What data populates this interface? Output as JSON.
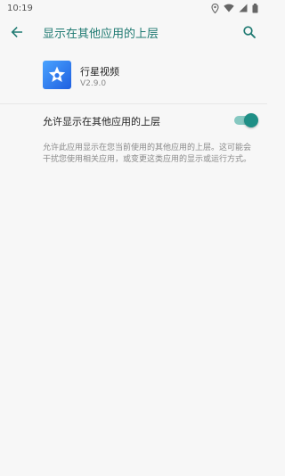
{
  "status_bar": {
    "time": "10:19",
    "icons": [
      "location-icon",
      "wifi-icon",
      "signal-icon",
      "battery-icon"
    ]
  },
  "app_bar": {
    "title": "显示在其他应用的上层",
    "back_icon": "back-arrow-icon",
    "search_icon": "search-icon",
    "accent_color": "#1f7a72"
  },
  "app": {
    "name": "行星视频",
    "version": "V2.9.0",
    "icon": "star-icon"
  },
  "setting": {
    "label": "允许显示在其他应用的上层",
    "enabled": true,
    "description": "允许此应用显示在您当前使用的其他应用的上层。这可能会干扰您使用相关应用，或变更这类应用的显示或运行方式。"
  },
  "colors": {
    "switch_thumb": "#1f8f86",
    "switch_track": "#86c8c1"
  }
}
